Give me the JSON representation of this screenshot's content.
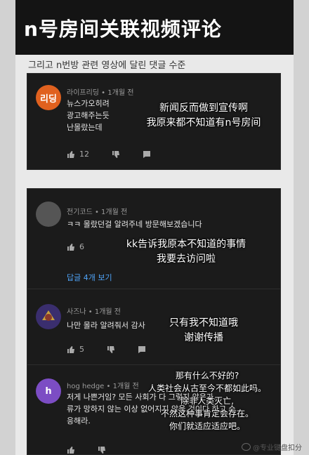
{
  "title": "n号房间关联视频评论",
  "subtitle": "그리고 n번방 관련 영상에 달린 댓글 수준",
  "comments": [
    {
      "avatar_text": "리딩",
      "avatar_color": "#e0611f",
      "author_meta": "라이프리딩 • 1개월 전",
      "text": "뉴스가오히려\n광고해주는듯\n난몰랐는데",
      "likes": "12",
      "overlay": "新闻反而做到宣传啊\n我原来都不知道有n号房间"
    },
    {
      "avatar_text": "",
      "avatar_color": "#555555",
      "author_meta": "전기코드 • 1개월 전",
      "text": "ㅋㅋ 몰랐던걸 알려주네 방문해보겠습니다",
      "likes": "6",
      "reply_label": "답글 4개 보기",
      "overlay": "kk告诉我原本不知道的事情\n我要去访问啦"
    },
    {
      "avatar_text": "",
      "avatar_color": "#3a2e6e",
      "author_meta": "사즈나 • 1개월 전",
      "text": "나만 몰라 알려줘서  감사",
      "likes": "5",
      "overlay": "只有我不知道哦\n谢谢传播"
    },
    {
      "avatar_text": "h",
      "avatar_color": "#7c4dc4",
      "author_meta": "hog hedge • 1개월 전",
      "text": "저게 나쁜거임? 모든 사회가 다 그렇지 않은가.   \n류가 망하지 않는 이상 없어지지 않을 것이다 하고 순\n응해라.",
      "overlay": "那有什么不好的?\n人类社会从古至今不都如此吗。\n除非人类灭亡,\n不然这种事肯定会存在。\n你们就适应适应吧。"
    }
  ],
  "watermark": "@专业键盘扣分"
}
